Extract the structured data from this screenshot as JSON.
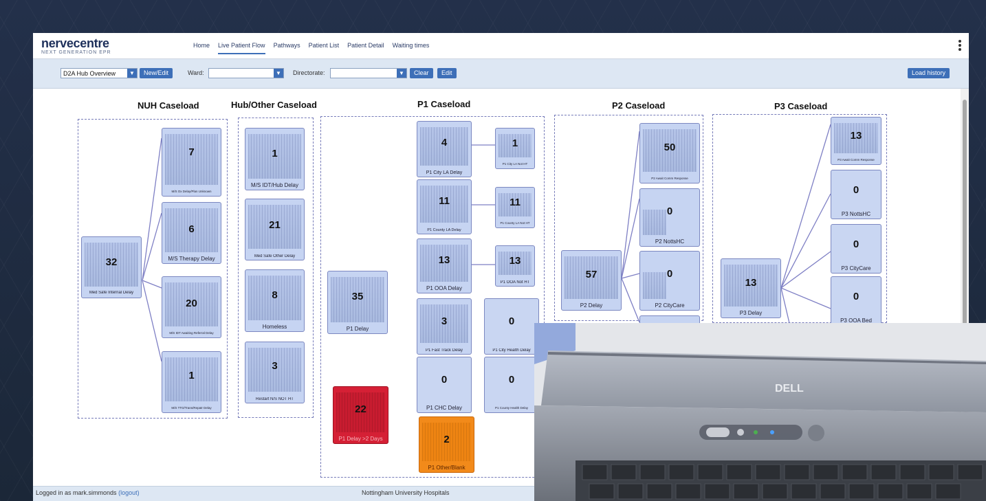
{
  "app": {
    "logo": "nervecentre",
    "logo_sub": "NEXT GENERATION EPR",
    "nav": [
      "Home",
      "Live Patient Flow",
      "Pathways",
      "Patient List",
      "Patient Detail",
      "Waiting times"
    ],
    "active_nav": "Live Patient Flow"
  },
  "toolbar": {
    "view_select": "D2A Hub Overview",
    "new_edit": "New/Edit",
    "ward_label": "Ward:",
    "ward_value": "",
    "directorate_label": "Directorate:",
    "directorate_value": "",
    "clear": "Clear",
    "edit": "Edit",
    "load_history": "Load history"
  },
  "sections": {
    "nuh": "NUH Caseload",
    "hub": "Hub/Other Caseload",
    "p1": "P1 Caseload",
    "p2": "P2 Caseload",
    "p3": "P3 Caseload"
  },
  "tiles": {
    "nuh_root": {
      "value": "32",
      "label": "Med Safe Internal Delay"
    },
    "nuh_1": {
      "value": "7",
      "label": "M/S Ox Delay/Plan Unknown"
    },
    "nuh_2": {
      "value": "6",
      "label": "M/S Therapy Delay"
    },
    "nuh_3": {
      "value": "20",
      "label": "M/S IDT Awaiting Referral Delay"
    },
    "nuh_4": {
      "value": "1",
      "label": "M/S TTO/Trans/Repatr Delay"
    },
    "hub_1": {
      "value": "1",
      "label": "M/S IDT/Hub Delay"
    },
    "hub_2": {
      "value": "21",
      "label": "Med Safe Other Delay"
    },
    "hub_3": {
      "value": "8",
      "label": "Homeless"
    },
    "hub_4": {
      "value": "3",
      "label": "Restart N/S NOT HT"
    },
    "p1_root": {
      "value": "35",
      "label": "P1 Delay"
    },
    "p1_red": {
      "value": "22",
      "label": "P1 Delay >2 Days"
    },
    "p1_city": {
      "value": "4",
      "label": "P1 City LA Delay"
    },
    "p1_city_nht": {
      "value": "1",
      "label": "P1 City LA Not HT"
    },
    "p1_county": {
      "value": "11",
      "label": "P1 County LA Delay"
    },
    "p1_county_nht": {
      "value": "11",
      "label": "P1 County LA Not HT"
    },
    "p1_ooa": {
      "value": "13",
      "label": "P1 OOA Delay"
    },
    "p1_ooa_nht": {
      "value": "13",
      "label": "P1 OOA Not HT"
    },
    "p1_fast": {
      "value": "3",
      "label": "P1 Fast Track Delay"
    },
    "p1_cityhealth": {
      "value": "0",
      "label": "P1 City Health Delay"
    },
    "p1_chc": {
      "value": "0",
      "label": "P1 CHC Delay"
    },
    "p1_countyhealth": {
      "value": "0",
      "label": "P1 County Health Delay"
    },
    "p1_other": {
      "value": "2",
      "label": "P1 Other/Blank"
    },
    "p2_root": {
      "value": "57",
      "label": "P2 Delay"
    },
    "p2_1": {
      "value": "50",
      "label": "P2 Await Comm Response"
    },
    "p2_2": {
      "value": "0",
      "label": "P2 NottsHC"
    },
    "p2_3": {
      "value": "0",
      "label": "P2 CityCare"
    },
    "p3_root": {
      "value": "13",
      "label": "P3 Delay"
    },
    "p3_1": {
      "value": "13",
      "label": "P3 Await Comm Response"
    },
    "p3_2": {
      "value": "0",
      "label": "P3 NottsHC"
    },
    "p3_3": {
      "value": "0",
      "label": "P3 CityCare"
    },
    "p3_4": {
      "value": "0",
      "label": "P3 OOA Bed"
    }
  },
  "footer": {
    "logged_in": "Logged in as mark.simmonds",
    "logout": "(logout)",
    "org": "Nottingham University Hospitals"
  },
  "photo": {
    "brand": "DELL"
  },
  "colors": {
    "accent": "#3d6fb8",
    "tile": "#c6d4f2",
    "alert_red": "#d52035",
    "alert_orange": "#f28a1a"
  }
}
